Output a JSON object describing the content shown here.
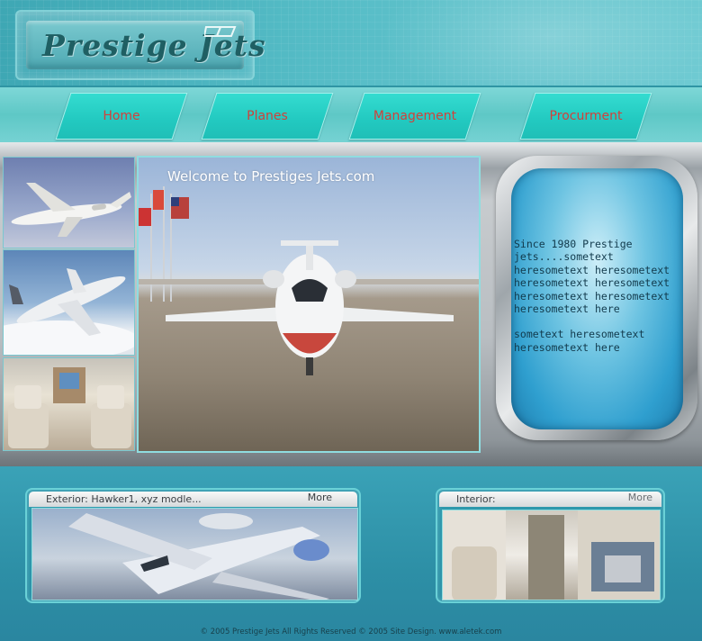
{
  "header": {
    "logo_text": "Prestige Jets"
  },
  "nav": {
    "items": [
      {
        "label": "Home"
      },
      {
        "label": "Planes"
      },
      {
        "label": "Management"
      },
      {
        "label": "Procurment"
      }
    ]
  },
  "hero": {
    "welcome": "Welcome to Prestiges Jets.com"
  },
  "window_panel": {
    "paragraph1": "Since 1980 Prestige jets....sometext heresometext heresometext heresometext heresometext heresometext heresometext heresometext here",
    "paragraph2": "sometext heresometext heresometext here"
  },
  "cards": {
    "exterior": {
      "title": "Exterior:   Hawker1, xyz modle...",
      "more": "More"
    },
    "interior": {
      "title": "Interior:",
      "more": "More"
    }
  },
  "footer": {
    "text": "© 2005 Prestige Jets All Rights Reserved © 2005 Site Design. www.aletek.com"
  },
  "colors": {
    "nav_text": "#d0413b",
    "nav_button": "#22c9c0",
    "header_bg": "#55bcc6",
    "bottom_bg": "#2d8fa6"
  }
}
